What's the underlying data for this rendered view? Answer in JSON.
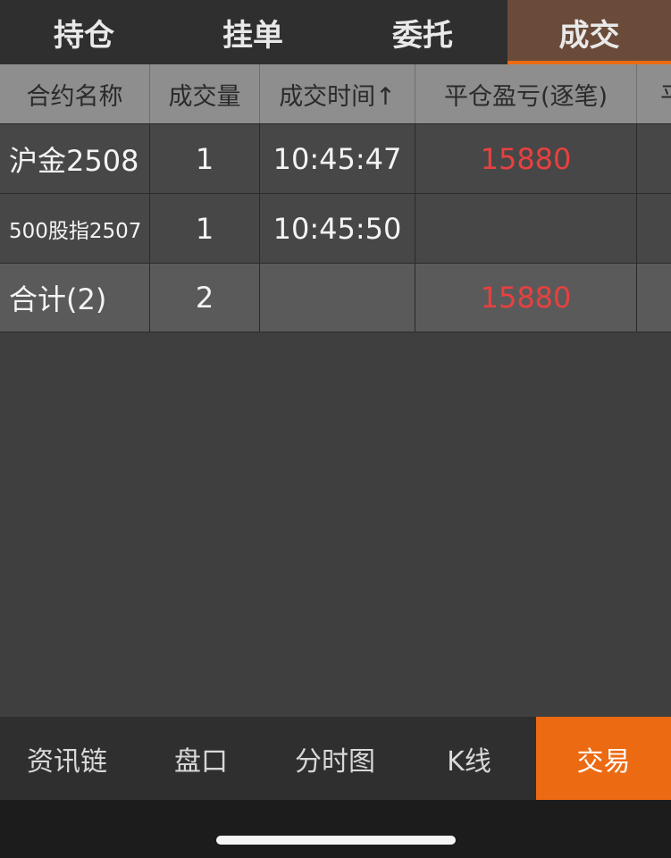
{
  "top_tabs": [
    {
      "label": "持仓"
    },
    {
      "label": "挂单"
    },
    {
      "label": "委托"
    },
    {
      "label": "成交"
    }
  ],
  "table": {
    "columns": [
      "合约名称",
      "成交量",
      "成交时间↑",
      "平仓盈亏(逐笔)",
      "平"
    ],
    "rows": [
      {
        "name": "沪金2508",
        "qty": "1",
        "time": "10:45:47",
        "pnl": "15880"
      },
      {
        "name": "500股指2507",
        "qty": "1",
        "time": "10:45:50",
        "pnl": ""
      }
    ],
    "summary": {
      "name": "合计(2)",
      "qty": "2",
      "time": "",
      "pnl": "15880"
    }
  },
  "bottom_nav": [
    {
      "label": "资讯链"
    },
    {
      "label": "盘口"
    },
    {
      "label": "分时图"
    },
    {
      "label": "K线"
    },
    {
      "label": "交易"
    }
  ],
  "colors": {
    "accent": "#ec6a12",
    "profit": "#e84040",
    "active_tab": "#6a4b39"
  }
}
